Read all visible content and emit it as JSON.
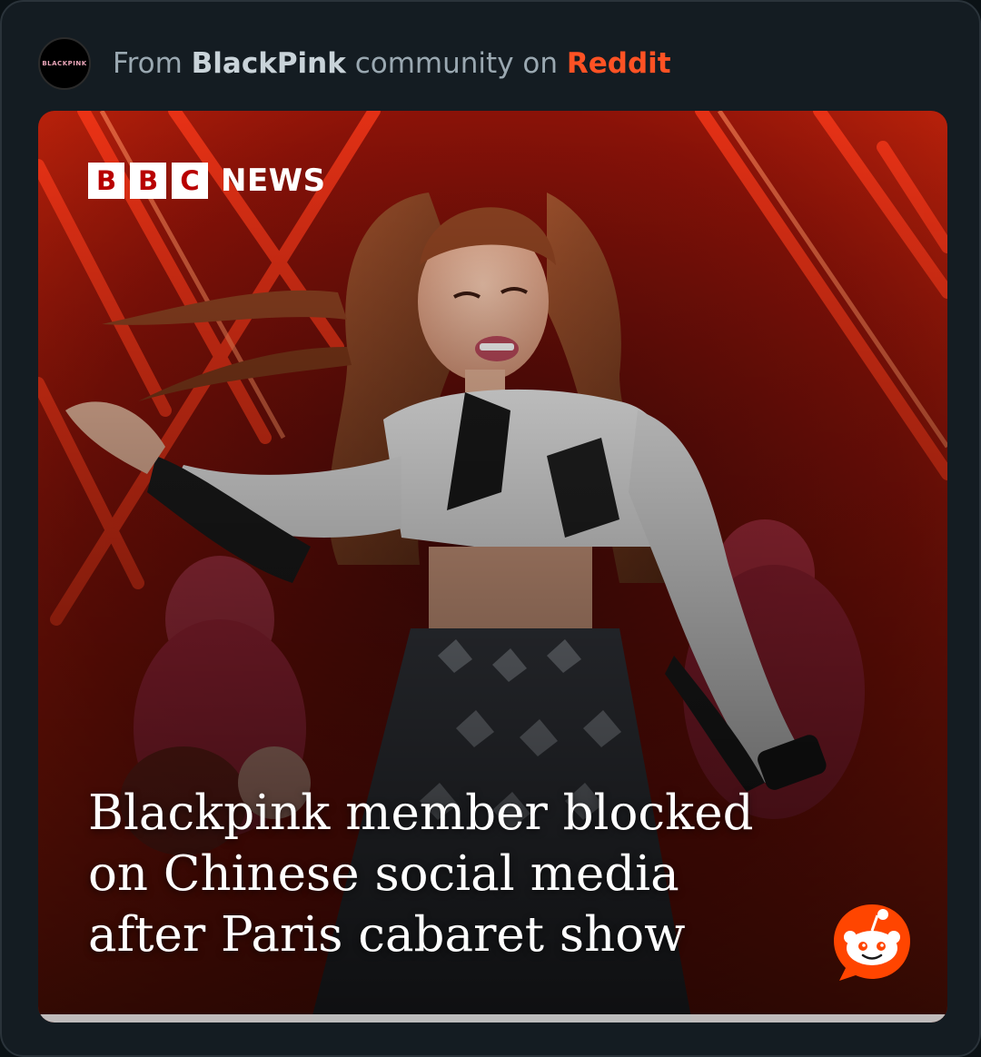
{
  "header": {
    "avatar_text": "BLACKPINK",
    "prefix": "From ",
    "community": "BlackPink",
    "middle": " community on ",
    "platform": "Reddit"
  },
  "media": {
    "logo_letters": [
      "B",
      "B",
      "C"
    ],
    "logo_word": "NEWS",
    "headline_lines": [
      "Blackpink member blocked",
      "on Chinese social media",
      "after Paris cabaret show"
    ]
  },
  "colors": {
    "accent_reddit": "#ff5224",
    "card_bg": "#141c22",
    "bbc_red": "#b80000"
  },
  "icons": {
    "reddit_badge": "reddit-snoo-icon"
  }
}
